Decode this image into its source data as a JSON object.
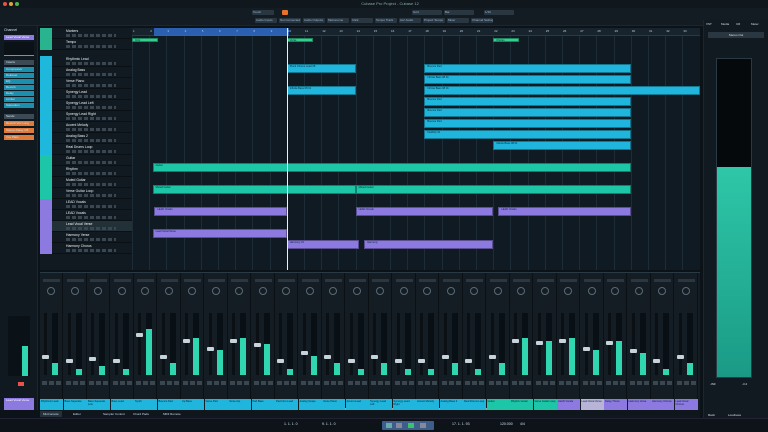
{
  "window": {
    "title": "Cubase Pro Project - Cubase 12"
  },
  "toolbar": {
    "automation_mode": "Touch",
    "snap": "Grid",
    "grid_type": "Bar",
    "quantize": "1/16",
    "tools": [
      "Audio Inputs",
      "Not Connected",
      "Audio Outputs",
      "Metronome",
      "Click",
      "Tempo Track",
      "Acc Audio",
      "Project Tempo",
      "Mixer",
      "Channel Settings"
    ]
  },
  "inspector": {
    "tab": "Channel",
    "track_label": "Lead Vocal Verse",
    "inserts_label": "Inserts",
    "inserts": [
      "Compressor",
      "DeEsser",
      "EQ",
      "Reverb",
      "Delay",
      "Limiter",
      "Saturation"
    ],
    "sends_label": "Sends",
    "sends": [
      "Reverb Vox Long",
      "Stereo Delay 1/8",
      "Vox Plate"
    ]
  },
  "tracks": [
    {
      "name": "Markers",
      "color": "#29b48f"
    },
    {
      "name": "Tempo",
      "color": "#29b48f"
    },
    {
      "name": "Rhythmic Lead",
      "color": "#1fb8dd"
    },
    {
      "name": "Analog Bass",
      "color": "#1fb8dd"
    },
    {
      "name": "Verse Piano",
      "color": "#1fb8dd"
    },
    {
      "name": "Synergy Lead",
      "color": "#1fb8dd"
    },
    {
      "name": "Synergy Lead Left",
      "color": "#1fb8dd"
    },
    {
      "name": "Synergy Lead Right",
      "color": "#1fb8dd"
    },
    {
      "name": "Accent Melody",
      "color": "#1fb8dd"
    },
    {
      "name": "Analog Bass 2",
      "color": "#1fb8dd"
    },
    {
      "name": "Real Drums Loop",
      "color": "#1fb8dd"
    },
    {
      "name": "Guitar",
      "color": "#1dc6a6"
    },
    {
      "name": "Rhythm",
      "color": "#1dc6a6"
    },
    {
      "name": "Muted Guitar",
      "color": "#1dc6a6"
    },
    {
      "name": "Verse Guitar Loop",
      "color": "#1dc6a6"
    },
    {
      "name": "LEAD Vocals",
      "color": "#8d7ae0"
    },
    {
      "name": "LEAD Vocals",
      "color": "#8d7ae0"
    },
    {
      "name": "Lead Vocal Verse",
      "color": "#8d7ae0"
    },
    {
      "name": "Harmony Verse",
      "color": "#8d7ae0"
    },
    {
      "name": "Harmony Chorus",
      "color": "#8d7ae0"
    }
  ],
  "ruler": {
    "bars": [
      1,
      2,
      3,
      4,
      5,
      6,
      7,
      8,
      9,
      10,
      11,
      12,
      13,
      14,
      15,
      16,
      17,
      18,
      19,
      20,
      21,
      22,
      23,
      24,
      25,
      26,
      27,
      28,
      29,
      30,
      31,
      32,
      33
    ]
  },
  "clips": [
    {
      "track": 0,
      "start": 1,
      "end": 2.5,
      "name": "Intro",
      "color": "#31d08f"
    },
    {
      "track": 0,
      "start": 10,
      "end": 11.5,
      "name": "Verse",
      "color": "#31d08f"
    },
    {
      "track": 0,
      "start": 22,
      "end": 23.5,
      "name": "Chorus",
      "color": "#31d08f"
    },
    {
      "track": 2,
      "start": 10,
      "end": 14,
      "name": "Pluck Chorus Lead 08",
      "color": "#20b5dc"
    },
    {
      "track": 2,
      "start": 18,
      "end": 30,
      "name": "Bounce Pad",
      "color": "#20b5dc"
    },
    {
      "track": 3,
      "start": 18,
      "end": 30,
      "name": "Infinite Bass 08 01",
      "color": "#20b5dc"
    },
    {
      "track": 4,
      "start": 10,
      "end": 14,
      "name": "Infinite Bass 08 01",
      "color": "#20b5dc"
    },
    {
      "track": 4,
      "start": 18,
      "end": 34,
      "name": "Infinite Bass 08 01",
      "color": "#20b5dc"
    },
    {
      "track": 5,
      "start": 18,
      "end": 30,
      "name": "Bounce Pad",
      "color": "#20b5dc"
    },
    {
      "track": 6,
      "start": 18,
      "end": 30,
      "name": "Bounce Pad",
      "color": "#20b5dc"
    },
    {
      "track": 7,
      "start": 18,
      "end": 30,
      "name": "Bounce Pad",
      "color": "#20b5dc"
    },
    {
      "track": 8,
      "start": 18,
      "end": 30,
      "name": "Fieldtrip 01",
      "color": "#20b5dc"
    },
    {
      "track": 9,
      "start": 22,
      "end": 30,
      "name": "Infinite Bass 08 01",
      "color": "#20b5dc"
    },
    {
      "track": 11,
      "start": 2.2,
      "end": 30,
      "name": "Guitar",
      "color": "#1dc6a6"
    },
    {
      "track": 13,
      "start": 2.2,
      "end": 14,
      "name": "Muted Guitar",
      "color": "#1dc6a6"
    },
    {
      "track": 13,
      "start": 14,
      "end": 30,
      "name": "Muted Guitar",
      "color": "#1dc6a6"
    },
    {
      "track": 15,
      "start": 2.3,
      "end": 10,
      "name": "LEAD Vocals",
      "color": "#8d7ae0"
    },
    {
      "track": 15,
      "start": 14,
      "end": 22,
      "name": "LEAD Vocals",
      "color": "#8d7ae0"
    },
    {
      "track": 15,
      "start": 22.3,
      "end": 30,
      "name": "LEAD Vocals",
      "color": "#8d7ae0"
    },
    {
      "track": 17,
      "start": 2.2,
      "end": 10,
      "name": "Lead Vocal Verse",
      "color": "#8d7ae0"
    },
    {
      "track": 18,
      "start": 10,
      "end": 14.2,
      "name": "Harmony 01",
      "color": "#8d7ae0"
    },
    {
      "track": 18,
      "start": 14.5,
      "end": 22,
      "name": "Harmony",
      "color": "#8d7ae0"
    }
  ],
  "mixer": {
    "channels": [
      {
        "name": "Rhythmic Lead",
        "level": 0.2,
        "color": "#20b5dc"
      },
      {
        "name": "Bass Seperate",
        "level": 0.1,
        "color": "#20b5dc"
      },
      {
        "name": "Bass Seperate Low",
        "level": 0.15,
        "color": "#20b5dc"
      },
      {
        "name": "Bass Lead",
        "level": 0.1,
        "color": "#20b5dc"
      },
      {
        "name": "Synth",
        "level": 0.75,
        "color": "#20b5dc"
      },
      {
        "name": "Bounce Pad",
        "level": 0.2,
        "color": "#20b5dc"
      },
      {
        "name": "Up Bass",
        "level": 0.6,
        "color": "#20b5dc"
      },
      {
        "name": "Verse Pad",
        "level": 0.4,
        "color": "#20b5dc"
      },
      {
        "name": "Verse Arp",
        "level": 0.6,
        "color": "#20b5dc"
      },
      {
        "name": "Pad Bass",
        "level": 0.5,
        "color": "#20b5dc"
      },
      {
        "name": "Pad Intro Lead",
        "level": 0.1,
        "color": "#20b5dc"
      },
      {
        "name": "Analog Scape",
        "level": 0.3,
        "color": "#20b5dc"
      },
      {
        "name": "Verse Piano",
        "level": 0.2,
        "color": "#20b5dc"
      },
      {
        "name": "Accent Lead",
        "level": 0.1,
        "color": "#20b5dc"
      },
      {
        "name": "Synergy Lead Left",
        "level": 0.2,
        "color": "#20b5dc"
      },
      {
        "name": "Synergy Lead Right",
        "level": 0.1,
        "color": "#20b5dc"
      },
      {
        "name": "Accent Melody",
        "level": 0.1,
        "color": "#20b5dc"
      },
      {
        "name": "Analog Bass 2",
        "level": 0.2,
        "color": "#20b5dc"
      },
      {
        "name": "Real Drums Loop",
        "level": 0.1,
        "color": "#20b5dc"
      },
      {
        "name": "Guitar",
        "level": 0.2,
        "color": "#1dc6a6"
      },
      {
        "name": "Rhythm Guitar",
        "level": 0.6,
        "color": "#1dc6a6"
      },
      {
        "name": "Verse Guitar Loop",
        "level": 0.55,
        "color": "#1dc6a6"
      },
      {
        "name": "LEAD Vocals",
        "level": 0.6,
        "color": "#8d7ae0"
      },
      {
        "name": "Lead Vocal Verse",
        "level": 0.4,
        "color": "#b8b4d8"
      },
      {
        "name": "Delay Throw",
        "level": 0.55,
        "color": "#8d7ae0"
      },
      {
        "name": "Harmony Verse",
        "level": 0.35,
        "color": "#8d7ae0"
      },
      {
        "name": "Harmony Chorus",
        "level": 0.1,
        "color": "#8d7ae0"
      },
      {
        "name": "Lead Vocal Chorus",
        "level": 0.2,
        "color": "#8d7ae0"
      }
    ]
  },
  "bottom_tabs": [
    "MixConsole",
    "Editor",
    "Sampler Control",
    "Chord Pads",
    "MIDI Remote"
  ],
  "transport": {
    "left_locator": "1. 1. 1. 0",
    "right_locator": "9. 1. 1. 0",
    "position": "17. 1. 1. 93",
    "tempo": "120.000",
    "signature": "4/4"
  },
  "right_panel": {
    "tabs": [
      "VST",
      "Media",
      "CR",
      "Meter"
    ],
    "section": "Stereo Out",
    "meter_level": 0.66,
    "readouts": [
      "-INF",
      "-3.2"
    ],
    "bottom_tabs": [
      "Rack",
      "Loudness"
    ]
  },
  "colors": {
    "audio": "#20b5dc",
    "guitar": "#1dc6a6",
    "vocals": "#8d7ae0",
    "markers": "#31d08f"
  }
}
